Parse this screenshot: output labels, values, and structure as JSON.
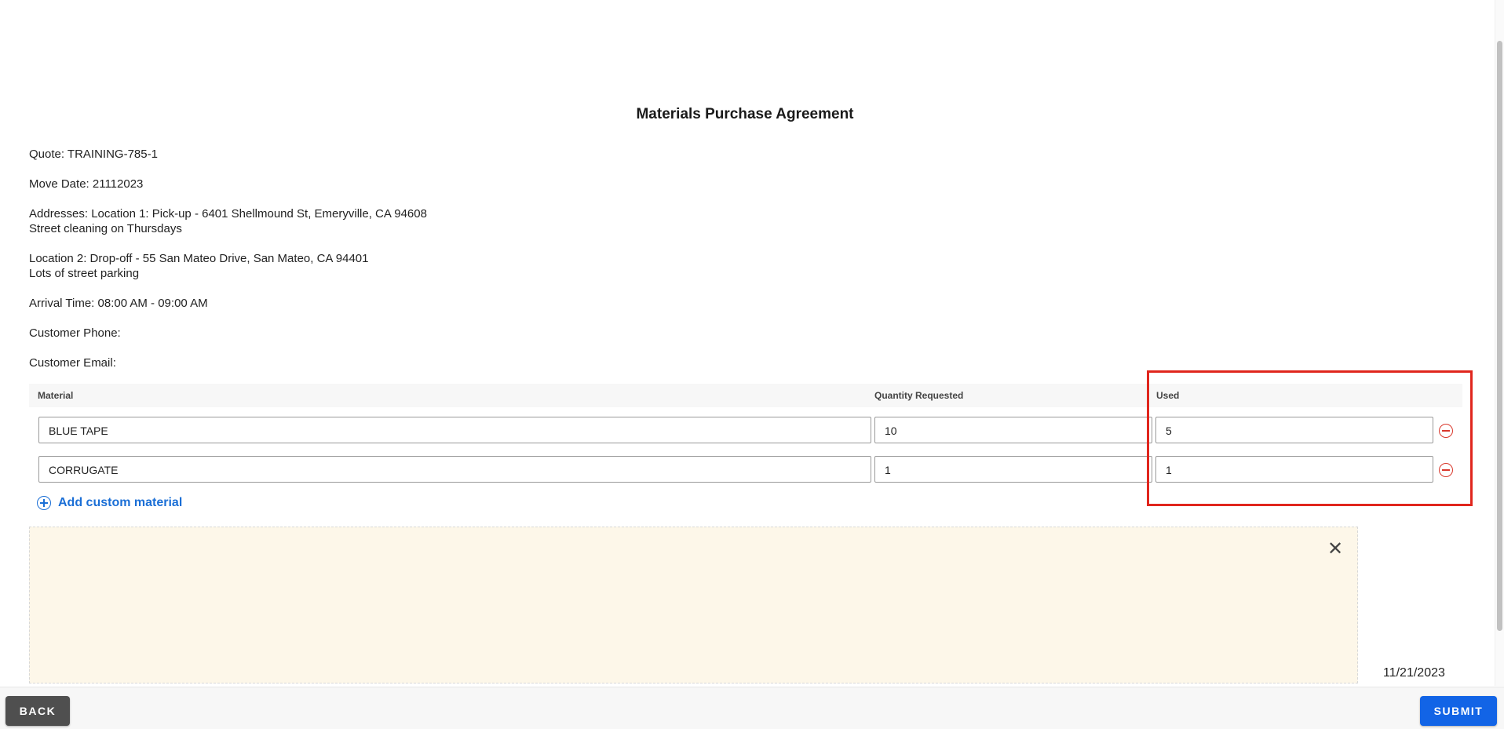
{
  "title": "Materials Purchase Agreement",
  "info": {
    "quote": "Quote: TRAINING-785-1",
    "move_date": "Move Date: 21112023",
    "location1": "Addresses: Location 1: Pick-up - 6401 Shellmound St, Emeryville, CA 94608",
    "location1_note": "Street cleaning on Thursdays",
    "location2": "Location 2: Drop-off - 55 San Mateo Drive, San Mateo, CA 94401",
    "location2_note": "Lots of street parking",
    "arrival_time": "Arrival Time: 08:00 AM - 09:00 AM",
    "customer_phone": "Customer Phone:",
    "customer_email": "Customer Email:"
  },
  "table": {
    "headers": [
      "Material",
      "Quantity Requested",
      "Used"
    ],
    "rows": [
      {
        "material": "BLUE TAPE",
        "quantity": "10",
        "used": "5"
      },
      {
        "material": "CORRUGATE",
        "quantity": "1",
        "used": "1"
      }
    ]
  },
  "add_custom_label": "Add custom material",
  "signature": {
    "close_icon": "✕",
    "date": "11/21/2023"
  },
  "footer": {
    "back_label": "BACK",
    "submit_label": "SUBMIT"
  },
  "colors": {
    "accent": "#1264e6",
    "danger": "#d9382c",
    "highlight": "#e0261d",
    "signature_bg": "#fdf7e9"
  }
}
